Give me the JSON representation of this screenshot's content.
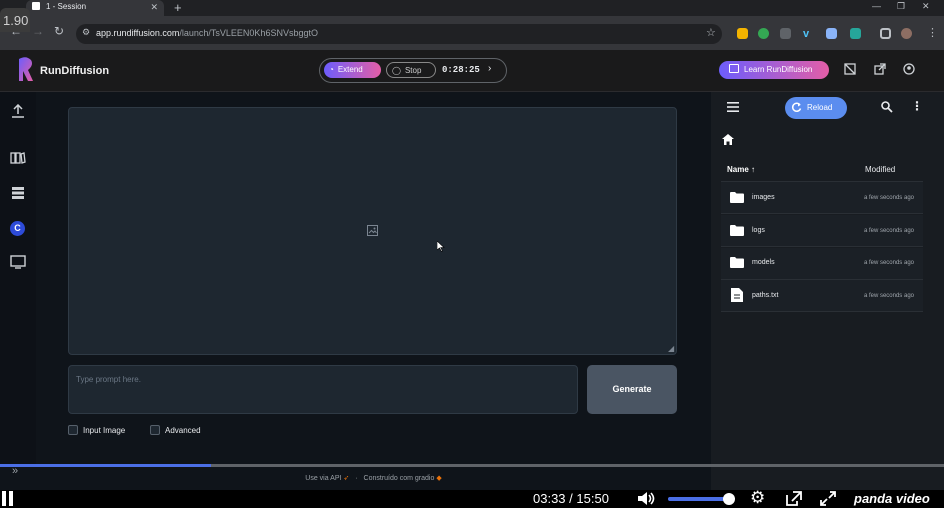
{
  "player": {
    "speed": "1.90",
    "current_time": "03:33",
    "separator": "/",
    "duration": "15:50",
    "progress_fraction": 0.224,
    "volume_fraction": 0.9,
    "brand": "panda video"
  },
  "browser": {
    "tab_title": "1 - Session",
    "new_tab": "+",
    "url_host": "app.rundiffusion.com",
    "url_path": "/launch/TsVLEEN0Kh6SNVsbggtO"
  },
  "header": {
    "brand": "RunDiffusion",
    "extend_label": "Extend",
    "stop_label": "Stop",
    "timer": "0:28:25",
    "learn_label": "Learn RunDiffusion"
  },
  "main": {
    "prompt_placeholder": "Type prompt here.",
    "generate_label": "Generate",
    "input_image_label": "Input Image",
    "advanced_label": "Advanced",
    "footer_api": "Use via API",
    "footer_dot": "·",
    "footer_built": "Construído com gradio"
  },
  "filepanel": {
    "reload_label": "Reload",
    "col_name": "Name",
    "col_modified": "Modified",
    "rows": [
      {
        "name": "images",
        "modified": "a few seconds ago",
        "kind": "folder"
      },
      {
        "name": "logs",
        "modified": "a few seconds ago",
        "kind": "folder"
      },
      {
        "name": "models",
        "modified": "a few seconds ago",
        "kind": "folder"
      },
      {
        "name": "paths.txt",
        "modified": "a few seconds ago",
        "kind": "file"
      }
    ]
  },
  "colors": {
    "accent_gradient_start": "#6d5dfc",
    "accent_gradient_end": "#e35ea7",
    "reload": "#5b8def",
    "progress": "#4b6fe6"
  }
}
